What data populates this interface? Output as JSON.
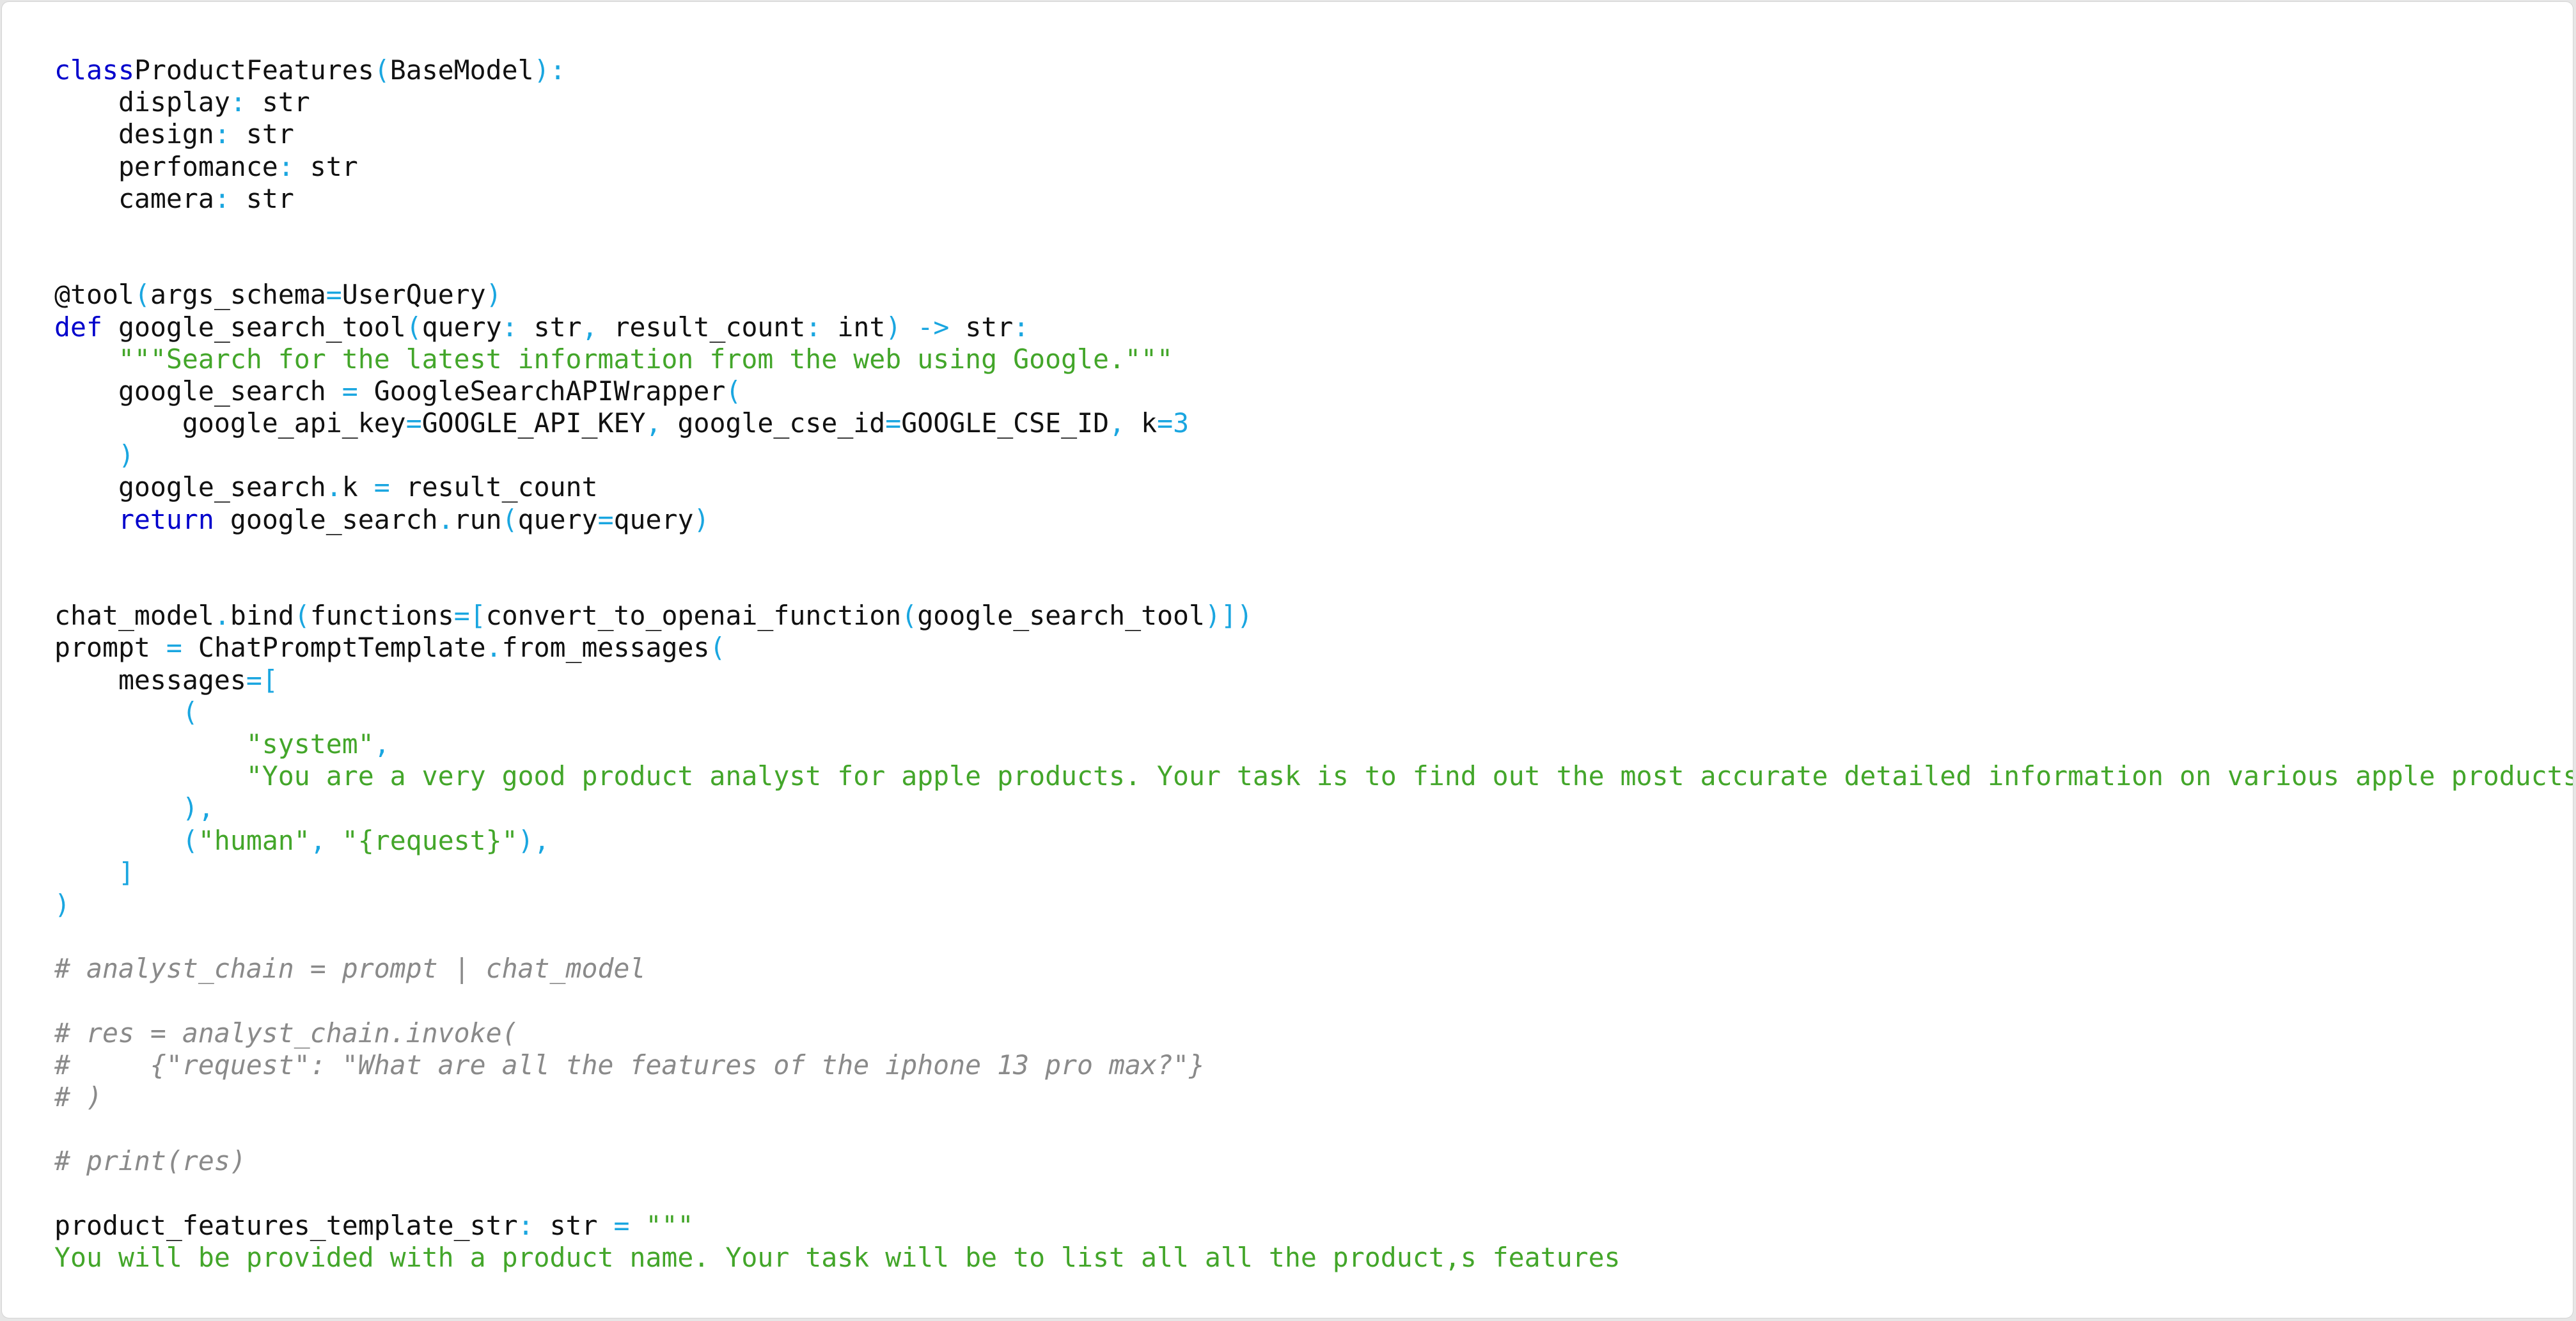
{
  "colors": {
    "keyword": "#0000cc",
    "operator": "#1aa6e0",
    "string": "#43a62a",
    "comment": "#8a8a8a",
    "identifier": "#111111",
    "background": "#ffffff"
  },
  "lines": [
    [
      [
        "kw",
        "class"
      ],
      [
        "",
        "ProductFeatures"
      ],
      [
        "op",
        "("
      ],
      [
        "",
        "BaseModel"
      ],
      [
        "op",
        "):"
      ]
    ],
    [
      [
        "",
        "    display"
      ],
      [
        "op",
        ":"
      ],
      [
        "",
        " str"
      ]
    ],
    [
      [
        "",
        "    design"
      ],
      [
        "op",
        ":"
      ],
      [
        "",
        " str"
      ]
    ],
    [
      [
        "",
        "    perfomance"
      ],
      [
        "op",
        ":"
      ],
      [
        "",
        " str"
      ]
    ],
    [
      [
        "",
        "    camera"
      ],
      [
        "op",
        ":"
      ],
      [
        "",
        " str"
      ]
    ],
    [],
    [],
    [
      [
        "",
        "@tool"
      ],
      [
        "op",
        "("
      ],
      [
        "",
        "args_schema"
      ],
      [
        "op",
        "="
      ],
      [
        "",
        "UserQuery"
      ],
      [
        "op",
        ")"
      ]
    ],
    [
      [
        "kw",
        "def"
      ],
      [
        "",
        " google_search_tool"
      ],
      [
        "op",
        "("
      ],
      [
        "",
        "query"
      ],
      [
        "op",
        ":"
      ],
      [
        "",
        " str"
      ],
      [
        "op",
        ","
      ],
      [
        "",
        " result_count"
      ],
      [
        "op",
        ":"
      ],
      [
        "",
        " int"
      ],
      [
        "op",
        ")"
      ],
      [
        "",
        " "
      ],
      [
        "op",
        "->"
      ],
      [
        "",
        " str"
      ],
      [
        "op",
        ":"
      ]
    ],
    [
      [
        "str",
        "    \"\"\"Search for the latest information from the web using Google.\"\"\""
      ]
    ],
    [
      [
        "",
        "    google_search "
      ],
      [
        "op",
        "="
      ],
      [
        "",
        " GoogleSearchAPIWrapper"
      ],
      [
        "op",
        "("
      ]
    ],
    [
      [
        "",
        "        google_api_key"
      ],
      [
        "op",
        "="
      ],
      [
        "",
        "GOOGLE_API_KEY"
      ],
      [
        "op",
        ","
      ],
      [
        "",
        " google_cse_id"
      ],
      [
        "op",
        "="
      ],
      [
        "",
        "GOOGLE_CSE_ID"
      ],
      [
        "op",
        ","
      ],
      [
        "",
        " k"
      ],
      [
        "op",
        "="
      ],
      [
        "num",
        "3"
      ]
    ],
    [
      [
        "op",
        "    )"
      ]
    ],
    [
      [
        "",
        "    google_search"
      ],
      [
        "op",
        "."
      ],
      [
        "",
        "k "
      ],
      [
        "op",
        "="
      ],
      [
        "",
        " result_count"
      ]
    ],
    [
      [
        "kw",
        "    return"
      ],
      [
        "",
        " google_search"
      ],
      [
        "op",
        "."
      ],
      [
        "",
        "run"
      ],
      [
        "op",
        "("
      ],
      [
        "",
        "query"
      ],
      [
        "op",
        "="
      ],
      [
        "",
        "query"
      ],
      [
        "op",
        ")"
      ]
    ],
    [],
    [],
    [
      [
        "",
        "chat_model"
      ],
      [
        "op",
        "."
      ],
      [
        "",
        "bind"
      ],
      [
        "op",
        "("
      ],
      [
        "",
        "functions"
      ],
      [
        "op",
        "=["
      ],
      [
        "",
        "convert_to_openai_function"
      ],
      [
        "op",
        "("
      ],
      [
        "",
        "google_search_tool"
      ],
      [
        "op",
        ")])"
      ]
    ],
    [
      [
        "",
        "prompt "
      ],
      [
        "op",
        "="
      ],
      [
        "",
        " ChatPromptTemplate"
      ],
      [
        "op",
        "."
      ],
      [
        "",
        "from_messages"
      ],
      [
        "op",
        "("
      ]
    ],
    [
      [
        "",
        "    messages"
      ],
      [
        "op",
        "=["
      ]
    ],
    [
      [
        "op",
        "        ("
      ]
    ],
    [
      [
        "str",
        "            \"system\""
      ],
      [
        "op",
        ","
      ]
    ],
    [
      [
        "str",
        "            \"You are a very good product analyst for apple products. Your task is to find out the most accurate detailed information on various apple products.\""
      ],
      [
        "op",
        ","
      ]
    ],
    [
      [
        "op",
        "        ),"
      ]
    ],
    [
      [
        "op",
        "        ("
      ],
      [
        "str",
        "\"human\""
      ],
      [
        "op",
        ","
      ],
      [
        "",
        " "
      ],
      [
        "str",
        "\"{request}\""
      ],
      [
        "op",
        "),"
      ]
    ],
    [
      [
        "op",
        "    ]"
      ]
    ],
    [
      [
        "op",
        ")"
      ]
    ],
    [],
    [
      [
        "cmt",
        "# analyst_chain = prompt | chat_model"
      ]
    ],
    [],
    [
      [
        "cmt",
        "# res = analyst_chain.invoke("
      ]
    ],
    [
      [
        "cmt",
        "#     {\"request\": \"What are all the features of the iphone 13 pro max?\"}"
      ]
    ],
    [
      [
        "cmt",
        "# )"
      ]
    ],
    [],
    [
      [
        "cmt",
        "# print(res)"
      ]
    ],
    [],
    [
      [
        "",
        "product_features_template_str"
      ],
      [
        "op",
        ":"
      ],
      [
        "",
        " str "
      ],
      [
        "op",
        "="
      ],
      [
        "",
        " "
      ],
      [
        "str",
        "\"\"\""
      ]
    ],
    [
      [
        "str",
        "You will be provided with a product name. Your task will be to list all all the product,s features"
      ]
    ]
  ]
}
